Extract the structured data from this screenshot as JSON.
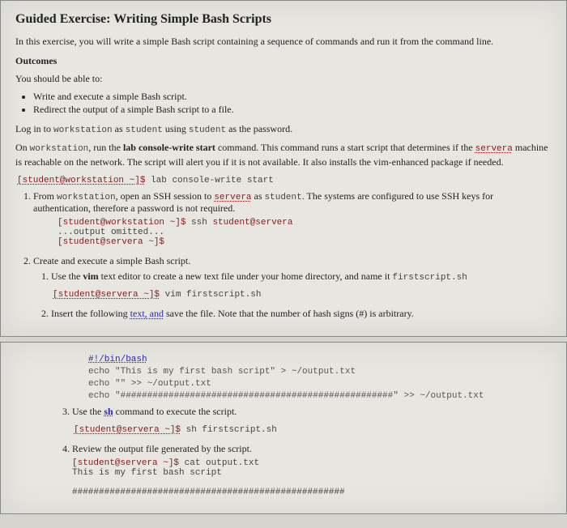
{
  "title": "Guided Exercise: Writing Simple Bash Scripts",
  "intro": "In this exercise, you will write a simple Bash script containing a sequence of commands and run it from the command line.",
  "outcomes_h": "Outcomes",
  "outcomes_lead": "You should be able to:",
  "outcomes": [
    "Write and execute a simple Bash script.",
    "Redirect the output of a simple Bash script to a file."
  ],
  "login_pre": "Log in to ",
  "login_ws": "workstation",
  "login_mid": " as ",
  "login_user": "student",
  "login_mid2": " using ",
  "login_pw": "student",
  "login_post": " as the password.",
  "onws_pre": "On ",
  "onws_ws": "workstation",
  "onws_mid1": ", run the ",
  "onws_cmd_bold": "lab console-write start",
  "onws_mid2": " command. This command runs a start script that determines if the ",
  "onws_servera": "servera",
  "onws_mid3": " machine is reachable on the network. The script will alert you if it is not available. It also installs the vim-enhanced package if needed.",
  "topcmd_prompt": "[student@workstation ~]$",
  "topcmd_cmd": " lab console-write start",
  "step1_pre": "From ",
  "step1_ws": "workstation",
  "step1_mid1": ", open an SSH session to ",
  "step1_servera": "servera",
  "step1_mid2": " as ",
  "step1_student": "student",
  "step1_post": ". The systems are configured to use SSH keys for authentication, therefore a password is not required.",
  "step1_block_l1a": "[student@workstation ~]$",
  "step1_block_l1b": " ssh ",
  "step1_block_l1c": "student@servera",
  "step1_block_l2": "...output omitted...",
  "step1_block_l3": "[student@servera ~]$",
  "step2_text": "Create and execute a simple Bash script.",
  "step2_1_pre": "Use the ",
  "step2_1_bold": "vim",
  "step2_1_mid": " text editor to create a new text file under your home directory, and name it ",
  "step2_1_fn": "firstscript.sh",
  "step2_1_cmd_prompt": "[student@servera ~]$",
  "step2_1_cmd": " vim firstscript.sh",
  "step2_2_pre": "Insert the following ",
  "step2_2_link": "text, and",
  "step2_2_post": " save the file. Note that the number of hash signs (#) is arbitrary.",
  "script_l1": "#!/bin/bash",
  "script_l2": "echo \"This is my first bash script\" > ~/output.txt",
  "script_l3": "echo \"\" >> ~/output.txt",
  "script_l4": "echo \"###################################################\" >> ~/output.txt",
  "step3_pre": "Use the ",
  "step3_bold": "sh",
  "step3_post": " command to execute the script.",
  "step3_cmd_prompt": "[student@servera ~]$",
  "step3_cmd": " sh firstscript.sh",
  "step4_text": "Review the output file generated by the script.",
  "step4_cmd_prompt": "[student@servera ~]$",
  "step4_cmd": " cat output.txt",
  "step4_out_l1": "This is my first bash script",
  "step4_out_l2": "",
  "step4_out_l3": "###################################################"
}
